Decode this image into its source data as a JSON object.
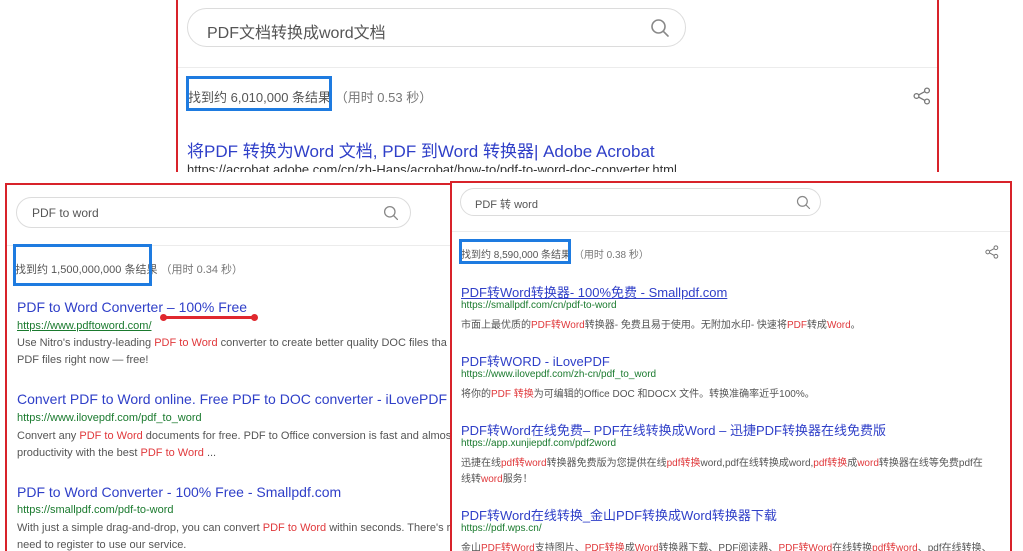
{
  "colors": {
    "link": "#2f3fc8",
    "url": "#1a7a2e",
    "keyword": "#e0383b",
    "panel_border": "#d8232a",
    "highlight_box": "#1e7be0"
  },
  "top": {
    "query": "PDF文档转换成word文档",
    "count": "找到约 6,010,000 条结果",
    "time": "（用时 0.53 秒）",
    "results": [
      {
        "title": "将PDF 转换为Word 文档, PDF 到Word 转换器| Adobe Acrobat",
        "url": "https://acrobat.adobe.com/cn/zh-Hans/acrobat/how-to/pdf-to-word-doc-converter.html"
      }
    ]
  },
  "left": {
    "query": "PDF to word",
    "count": "找到约 1,500,000,000 条结果",
    "time": "（用时 0.34 秒）",
    "results": [
      {
        "title": "PDF to Word Converter – 100% Free",
        "url": "https://www.pdftoword.com/",
        "d1a": "Use Nitro's industry-leading ",
        "d1b": "PDF to Word",
        "d1c": " converter to create better quality DOC files tha",
        "d2": "PDF files right now — free!"
      },
      {
        "title": "Convert PDF to Word online. Free PDF to DOC converter - iLovePDF",
        "url": "https://www.ilovepdf.com/pdf_to_word",
        "d1a": "Convert any ",
        "d1b": "PDF to Word",
        "d1c": " documents for free. PDF to Office conversion is fast and almost",
        "d2a": "productivity with the best ",
        "d2b": "PDF to Word",
        "d2c": " ..."
      },
      {
        "title": "PDF to Word Converter - 100% Free - Smallpdf.com",
        "url": "https://smallpdf.com/pdf-to-word",
        "d1a": "With just a simple drag-and-drop, you can convert ",
        "d1b": "PDF to Word",
        "d1c": " within seconds. There's r",
        "d2": "need to register to use our service."
      }
    ]
  },
  "right": {
    "query": "PDF 转 word",
    "count": "找到约 8,590,000 条结果",
    "time": "（用时 0.38 秒）",
    "results": [
      {
        "title": "PDF转Word转换器- 100%免费 - Smallpdf.com",
        "url": "https://smallpdf.com/cn/pdf-to-word",
        "d1": [
          "市面上最优质的",
          "PDF转Word",
          "转换器- 免费且易于使用。无附加水印- 快速将",
          "PDF",
          "转成",
          "Word",
          "。"
        ]
      },
      {
        "title": "PDF转WORD - iLovePDF",
        "url": "https://www.ilovepdf.com/zh-cn/pdf_to_word",
        "d1": [
          "将你的",
          "PDF 转换",
          "为可编辑的Office DOC 和DOCX 文件。转换准确率近乎100%。"
        ]
      },
      {
        "title": "PDF转Word在线免费– PDF在线转换成Word – 迅捷PDF转换器在线免费版",
        "url": "https://app.xunjiepdf.com/pdf2word",
        "d1": [
          "迅捷在线",
          "pdf转word",
          "转换器免费版为您提供在线",
          "pdf转换",
          "word,pdf在线转换成word,",
          "pdf转换",
          "成",
          "word",
          "转换器在线等免费pdf在"
        ],
        "d2": [
          "线转",
          "word",
          "服务！"
        ]
      },
      {
        "title": "PDF转Word在线转换_金山PDF转换成Word转换器下载",
        "url": "https://pdf.wps.cn/",
        "d1": [
          "金山",
          "PDF转Word",
          "支持图片、",
          "PDF转换",
          "成",
          "Word",
          "转换器下载、PDF阅读器、",
          "PDF转Word",
          "在线转换",
          "pdf转word",
          "、pdf在线转换、"
        ]
      }
    ]
  }
}
